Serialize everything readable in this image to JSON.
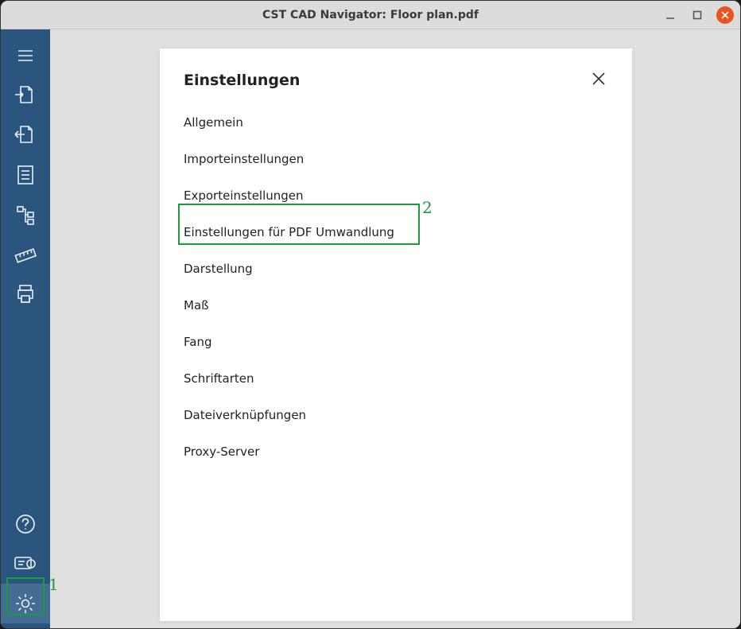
{
  "titlebar": {
    "title": "CST CAD Navigator: Floor plan.pdf"
  },
  "settings": {
    "title": "Einstellungen",
    "items": [
      "Allgemein",
      "Importeinstellungen",
      "Exporteinstellungen",
      "Einstellungen für PDF Umwandlung",
      "Darstellung",
      "Maß",
      "Fang",
      "Schriftarten",
      "Dateiverknüpfungen",
      "Proxy-Server"
    ]
  },
  "sidebar_icons": [
    "menu-icon",
    "import-icon",
    "export-icon",
    "document-icon",
    "tree-icon",
    "ruler-icon",
    "print-icon"
  ],
  "sidebar_bottom_icons": [
    "help-icon",
    "license-icon",
    "settings-icon"
  ],
  "annotations": {
    "1": "1",
    "2": "2"
  }
}
